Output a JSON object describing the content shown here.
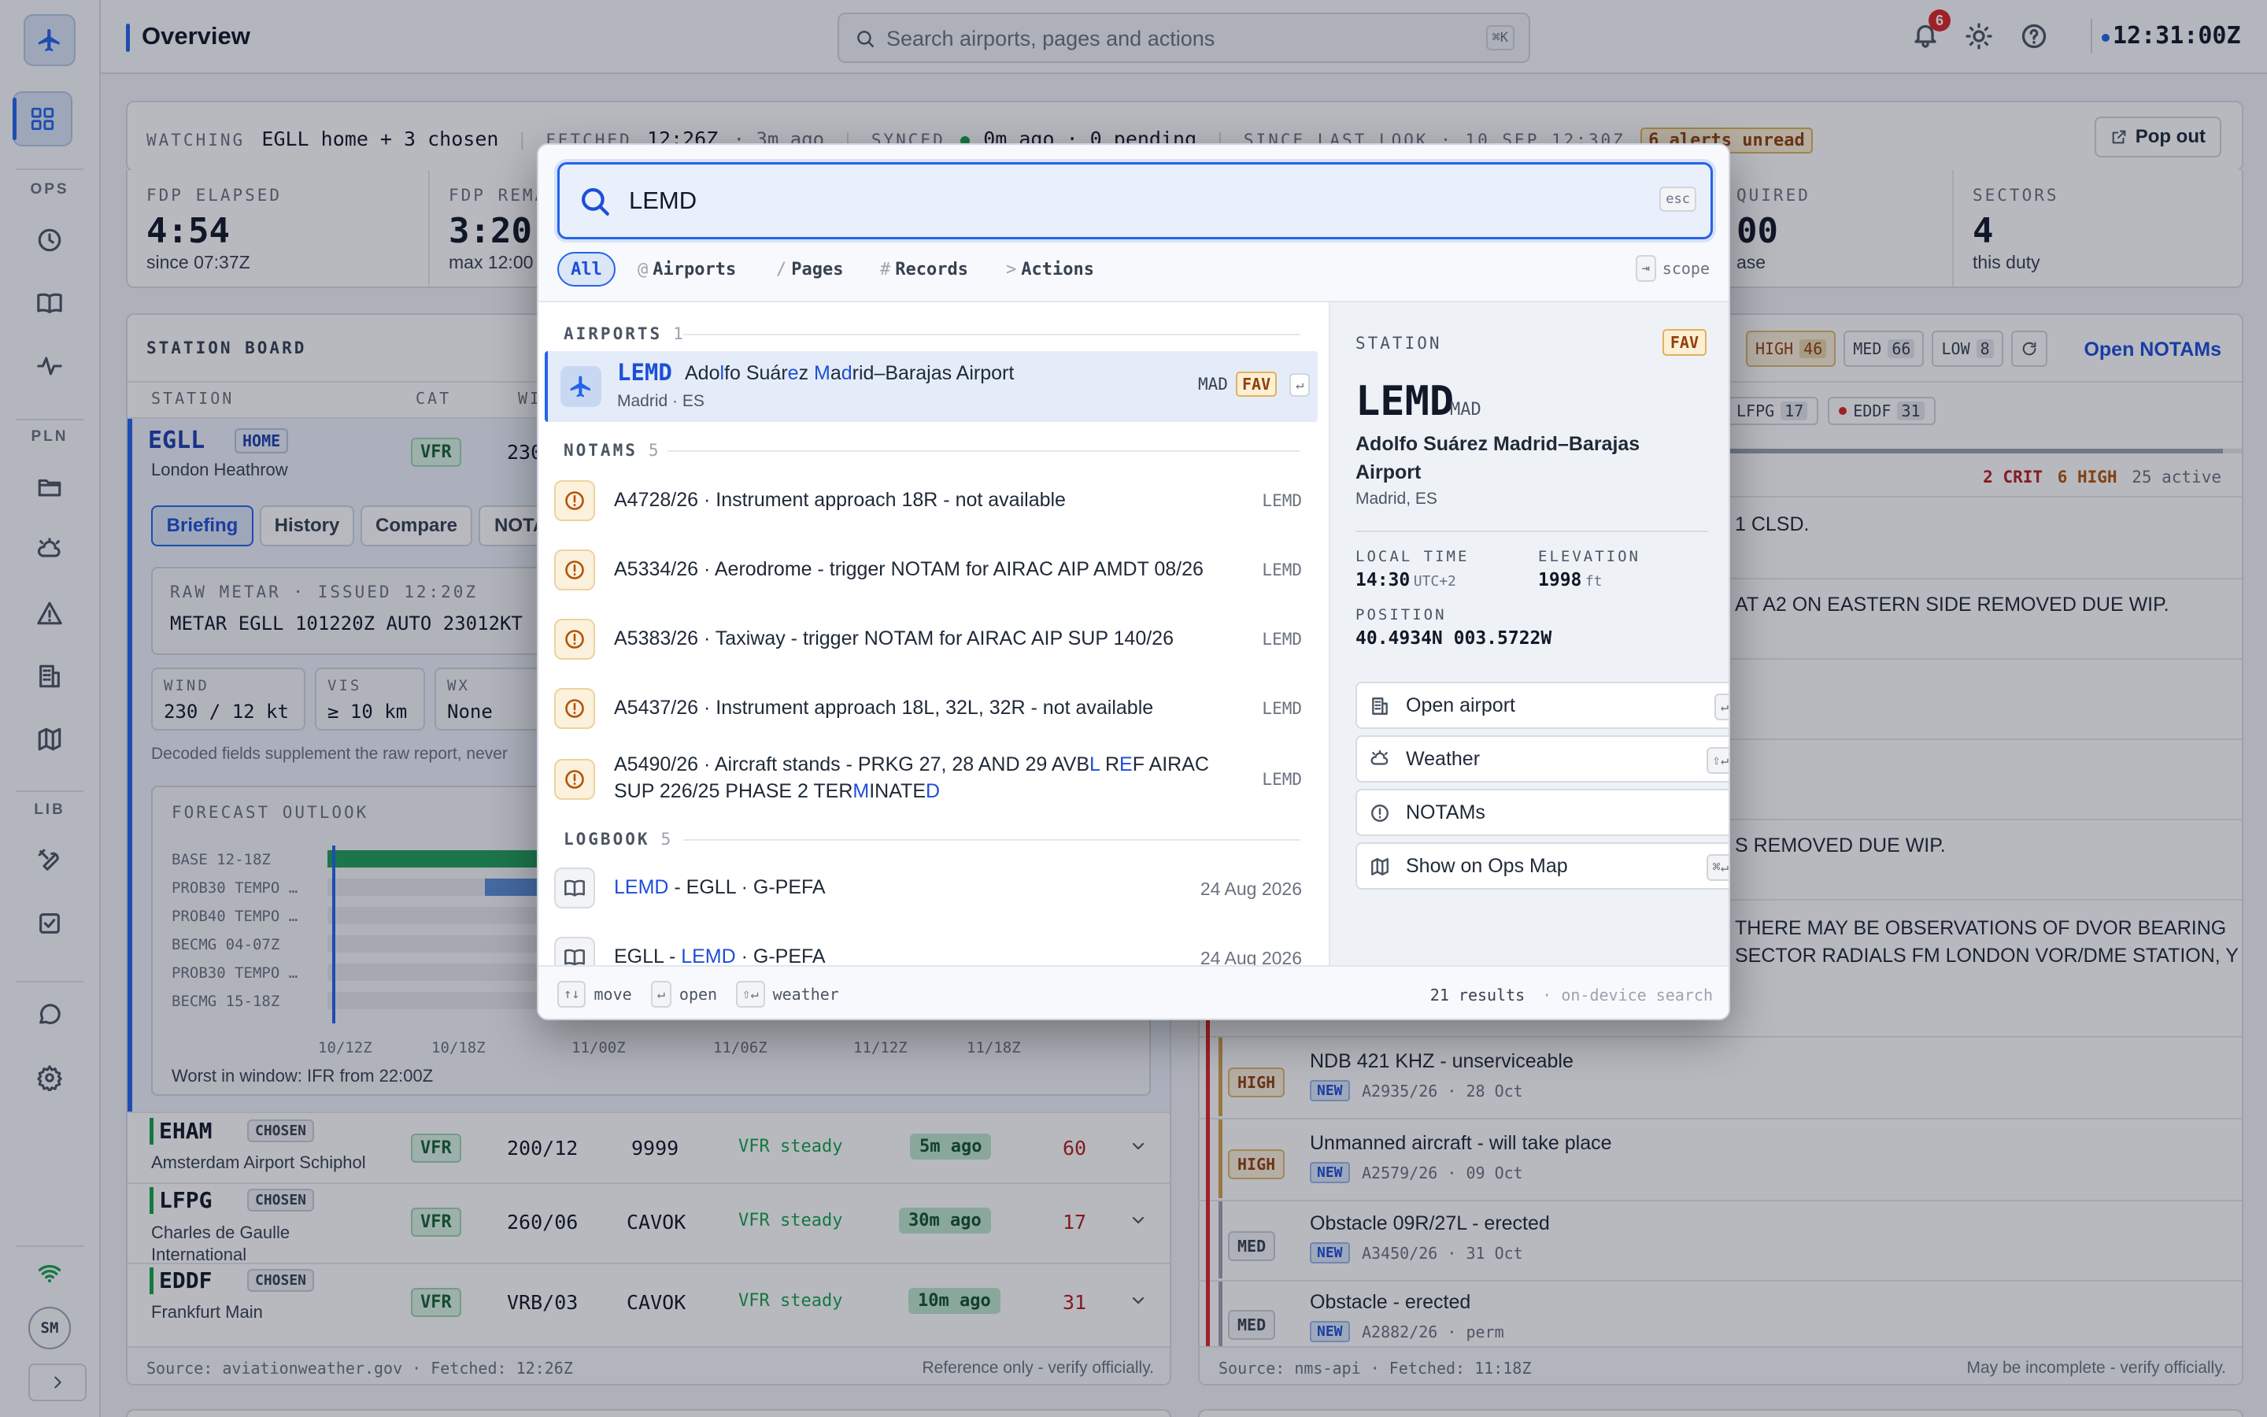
{
  "app": {
    "page_title": "Overview",
    "search_placeholder": "Search airports, pages and actions",
    "search_shortcut": "⌘K",
    "notification_count": "6",
    "clock": "12:31:00Z",
    "brand_color": "#2563eb"
  },
  "sidebar": {
    "sections": [
      "OPS",
      "PLN",
      "LIB"
    ],
    "items": [
      "overview-icon",
      "clock-icon",
      "book-icon",
      "activity-icon",
      "folder-icon",
      "weather-icon",
      "warning-icon",
      "building-icon",
      "map-icon",
      "tools-icon",
      "checklist-icon",
      "chat-icon",
      "gear-icon"
    ],
    "user_initials": "SM",
    "expand": ">"
  },
  "watch": {
    "watching_label": "WATCHING",
    "watching_value": "EGLL home + 3 chosen",
    "fetched_label": "FETCHED",
    "fetched_value": "12:26Z",
    "fetched_ago": "· 3m ago",
    "synced_label": "SYNCED",
    "synced_value": "0m ago · 0 pending",
    "since_label": "SINCE LAST LOOK · 10 SEP 12:30Z",
    "alerts": "6 alerts unread",
    "popout": "Pop out"
  },
  "stats": [
    {
      "label": "FDP ELAPSED",
      "value": "4:54",
      "sub": "since 07:37Z"
    },
    {
      "label": "FDP REMA",
      "value": "3:20",
      "sub": "max 12:00"
    },
    {
      "label": "QUIRED",
      "value": "00",
      "sub": "ase"
    },
    {
      "label": "SECTORS",
      "value": "4",
      "sub": "this duty"
    }
  ],
  "station_board": {
    "title": "STATION BOARD",
    "columns": [
      "STATION",
      "CAT",
      "WI"
    ],
    "home": {
      "code": "EGLL",
      "tag": "HOME",
      "name": "London Heathrow",
      "cat": "VFR",
      "wind": "230"
    },
    "tabs": [
      "Briefing",
      "History",
      "Compare",
      "NOTA"
    ],
    "metar_label": "RAW METAR · ISSUED 12:20Z",
    "metar_text": "METAR EGLL 101220Z AUTO 23012KT",
    "decoded": [
      {
        "label": "WIND",
        "value": "230 / 12 kt"
      },
      {
        "label": "VIS",
        "value": "≥ 10 km"
      },
      {
        "label": "WX",
        "value": "None"
      }
    ],
    "decoded_note": "Decoded fields supplement the raw report, never",
    "forecast_label": "FORECAST OUTLOOK",
    "forecast_rows": [
      "BASE 12-18Z",
      "PROB30 TEMPO …",
      "PROB40 TEMPO …",
      "BECMG 04-07Z",
      "PROB30 TEMPO …",
      "BECMG 15-18Z"
    ],
    "forecast_ticks": [
      "10/12Z",
      "10/18Z",
      "11/00Z",
      "11/06Z",
      "11/12Z",
      "11/18Z"
    ],
    "worst": "Worst in window: IFR from 22:00Z",
    "rows": [
      {
        "code": "EHAM",
        "tag": "CHOSEN",
        "name": "Amsterdam Airport Schiphol",
        "cat": "VFR",
        "wind": "200/12",
        "vis": "9999",
        "trend": "VFR steady",
        "ago": "5m ago",
        "notams": "60"
      },
      {
        "code": "LFPG",
        "tag": "CHOSEN",
        "name": "Charles de Gaulle International",
        "cat": "VFR",
        "wind": "260/06",
        "vis": "CAVOK",
        "trend": "VFR steady",
        "ago": "30m ago",
        "notams": "17"
      },
      {
        "code": "EDDF",
        "tag": "CHOSEN",
        "name": "Frankfurt Main",
        "cat": "VFR",
        "wind": "VRB/03",
        "vis": "CAVOK",
        "trend": "VFR steady",
        "ago": "10m ago",
        "notams": "31"
      }
    ],
    "footer_source": "Source: aviationweather.gov · Fetched: 12:26Z",
    "footer_note": "Reference only - verify officially."
  },
  "notam_panel": {
    "filters": [
      {
        "label": "HIGH",
        "count": "46"
      },
      {
        "label": "MED",
        "count": "66"
      },
      {
        "label": "LOW",
        "count": "8"
      }
    ],
    "open_link": "Open NOTAMs",
    "station_chips": [
      {
        "code": "LFPG",
        "count": "17"
      },
      {
        "code": "EDDF",
        "count": "31"
      }
    ],
    "summary_crit": "2 CRIT",
    "summary_high": "6 HIGH",
    "summary_active": "25 active",
    "partial_rows": [
      "1 CLSD.",
      "AT A2 ON EASTERN SIDE REMOVED DUE WIP.",
      "S REMOVED DUE WIP.",
      "THERE MAY BE OBSERVATIONS OF DVOR BEARING SECTOR RADIALS FM LONDON VOR/DME STATION, Y"
    ],
    "items": [
      {
        "sev": "HIGH",
        "title": "NDB 421 KHZ - unserviceable",
        "id": "A2935/26 · 28 Oct"
      },
      {
        "sev": "HIGH",
        "title": "Unmanned aircraft - will take place",
        "id": "A2579/26 · 09 Oct"
      },
      {
        "sev": "MED",
        "title": "Obstacle 09R/27L - erected",
        "id": "A3450/26 · 31 Oct"
      },
      {
        "sev": "MED",
        "title": "Obstacle - erected",
        "id": "A2882/26 · perm"
      }
    ],
    "new_tag": "NEW",
    "footer_source": "Source: nms-api · Fetched: 11:18Z",
    "footer_note": "May be incomplete - verify officially."
  },
  "palette": {
    "query": "LEMD",
    "esc": "esc",
    "tabs": [
      {
        "prefix": "",
        "label": "All"
      },
      {
        "prefix": "@",
        "label": "Airports"
      },
      {
        "prefix": "/",
        "label": "Pages"
      },
      {
        "prefix": "#",
        "label": "Records"
      },
      {
        "prefix": ">",
        "label": "Actions"
      }
    ],
    "scope_key": "⇥",
    "scope_label": "scope",
    "airports_label": "AIRPORTS",
    "airports_count": "1",
    "airport": {
      "code": "LEMD",
      "name_parts": [
        "Ado",
        "l",
        "fo Suár",
        "e",
        "z ",
        "M",
        "a",
        "d",
        "rid–Barajas Airport"
      ],
      "sub": "Madrid · ES",
      "iata": "MAD",
      "fav": "FAV",
      "enter": "↵"
    },
    "notams_label": "NOTAMS",
    "notams_count": "5",
    "notams": [
      {
        "text": "A4728/26 · Instrument approach 18R - not available",
        "code": "LEMD"
      },
      {
        "text": "A5334/26 · Aerodrome - trigger NOTAM for AIRAC AIP AMDT 08/26",
        "code": "LEMD"
      },
      {
        "text": "A5383/26 · Taxiway - trigger NOTAM for AIRAC AIP SUP 140/26",
        "code": "LEMD"
      },
      {
        "text": "A5437/26 · Instrument approach 18L, 32L, 32R - not available",
        "code": "LEMD"
      },
      {
        "text_parts": [
          "A5490/26 · Aircraft stands - PRKG 27, 28 AND 29 AVB",
          "L",
          " R",
          "E",
          "F AIRAC",
          "SUP 226/25 PHASE 2 TER",
          "M",
          "INATE",
          "D"
        ],
        "code": "LEMD"
      }
    ],
    "logbook_label": "LOGBOOK",
    "logbook_count": "5",
    "logbook": [
      {
        "hl": "LEMD",
        "rest": " - EGLL · G-PEFA",
        "date": "24 Aug 2026"
      },
      {
        "pre": "EGLL - ",
        "hl": "LEMD",
        "rest": " · G-PEFA",
        "date": "24 Aug 2026"
      }
    ],
    "preview": {
      "label": "STATION",
      "fav": "FAV",
      "code": "LEMD",
      "iata": "MAD",
      "name": "Adolfo Suárez Madrid–Barajas Airport",
      "place": "Madrid, ES",
      "local_time_label": "LOCAL TIME",
      "local_time": "14:30",
      "tz": "UTC+2",
      "elevation_label": "ELEVATION",
      "elevation": "1998",
      "elevation_unit": "ft",
      "position_label": "POSITION",
      "position": "40.4934N 003.5722W",
      "actions": [
        {
          "label": "Open airport",
          "key": "↵",
          "icon": "building-icon"
        },
        {
          "label": "Weather",
          "key": "⇧↵",
          "icon": "weather-icon"
        },
        {
          "label": "NOTAMs",
          "key": "",
          "icon": "alert-circle-icon"
        },
        {
          "label": "Show on Ops Map",
          "key": "⌘↵",
          "icon": "map-icon"
        }
      ]
    },
    "footer": {
      "move_key": "↑↓",
      "move": "move",
      "open_key": "↵",
      "open": "open",
      "weather_key": "⇧↵",
      "weather": "weather",
      "results": "21 results",
      "mode": "· on-device search"
    }
  }
}
